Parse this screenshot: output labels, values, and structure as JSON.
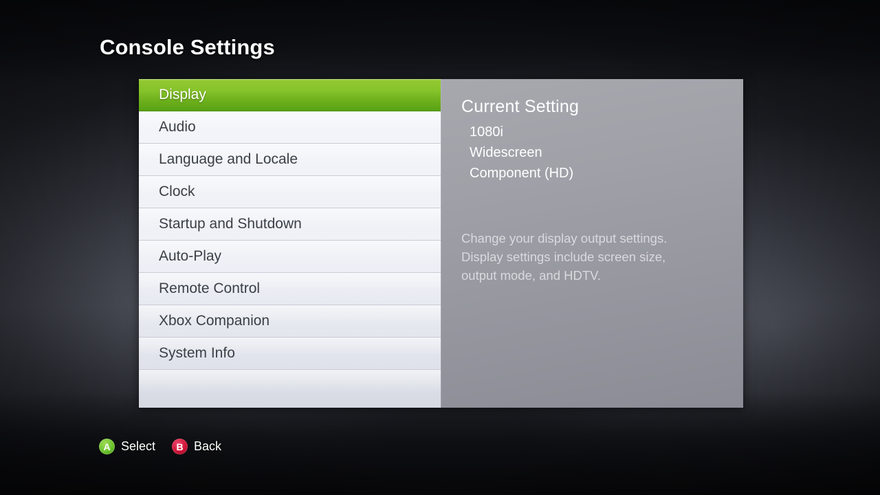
{
  "page": {
    "title": "Console Settings"
  },
  "menu": {
    "items": [
      {
        "label": "Display",
        "selected": true
      },
      {
        "label": "Audio",
        "selected": false
      },
      {
        "label": "Language and Locale",
        "selected": false
      },
      {
        "label": "Clock",
        "selected": false
      },
      {
        "label": "Startup and Shutdown",
        "selected": false
      },
      {
        "label": "Auto-Play",
        "selected": false
      },
      {
        "label": "Remote Control",
        "selected": false
      },
      {
        "label": "Xbox Companion",
        "selected": false
      },
      {
        "label": "System Info",
        "selected": false
      }
    ]
  },
  "info_panel": {
    "heading": "Current Setting",
    "values": [
      "1080i",
      "Widescreen",
      "Component (HD)"
    ],
    "description_lines": [
      "Change your display output settings.",
      "Display settings include screen size,",
      "output mode, and HDTV."
    ]
  },
  "legend": {
    "buttons": [
      {
        "glyph": "A",
        "label": "Select",
        "color": "#6cc22e",
        "icon": "a-button-icon"
      },
      {
        "glyph": "B",
        "label": "Back",
        "color": "#cf1638",
        "icon": "b-button-icon"
      }
    ]
  },
  "colors": {
    "accent_green": "#86c32a",
    "accent_red": "#cf1638",
    "panel_gray": "#9a9ba2",
    "list_white": "#f1f3f8",
    "background_dark": "#26282f"
  }
}
